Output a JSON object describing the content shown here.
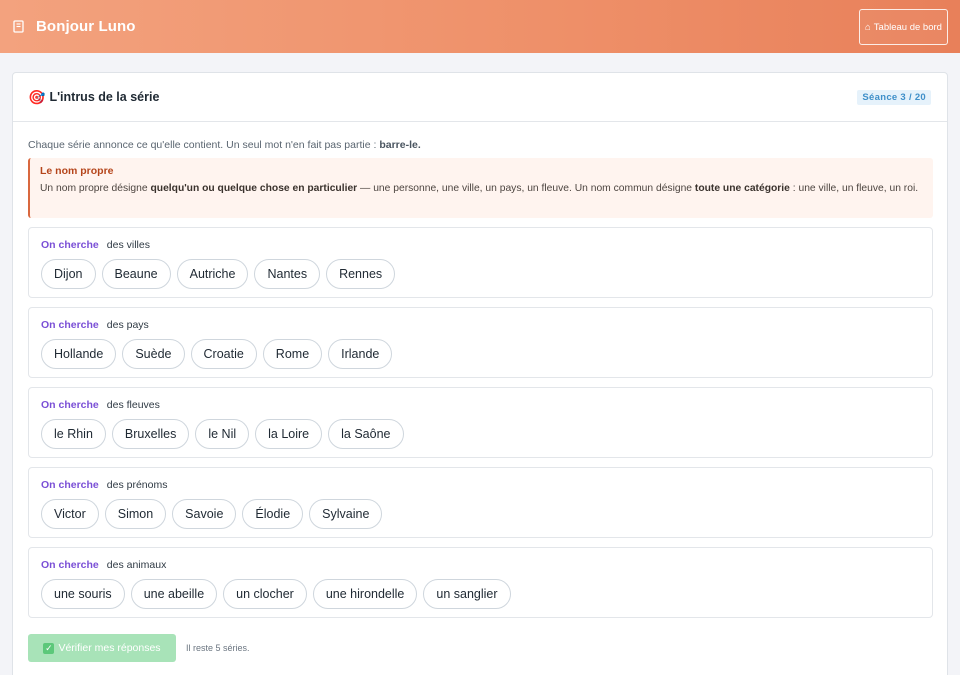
{
  "header": {
    "title": "Bonjour Luno",
    "dashboard_label": "Tableau de bord"
  },
  "card": {
    "title": "L'intrus de la série",
    "badge": "Séance 3 / 20",
    "intro_text": "Chaque série annonce ce qu'elle contient. Un seul mot n'en fait pas partie : ",
    "intro_strong": "barre-le."
  },
  "rule": {
    "title": "Le nom propre",
    "t1": "Un nom propre désigne ",
    "b1": "quelqu'un ou quelque chose en particulier",
    "t2": " — une personne, une ville, un pays, un fleuve. Un nom commun désigne ",
    "b2": "toute une catégorie",
    "t3": " : une ville, un fleuve, un roi."
  },
  "series": [
    {
      "key": "On cherche",
      "value": "des villes",
      "words": [
        "Dijon",
        "Beaune",
        "Autriche",
        "Nantes",
        "Rennes"
      ]
    },
    {
      "key": "On cherche",
      "value": "des pays",
      "words": [
        "Hollande",
        "Suède",
        "Croatie",
        "Rome",
        "Irlande"
      ]
    },
    {
      "key": "On cherche",
      "value": "des fleuves",
      "words": [
        "le Rhin",
        "Bruxelles",
        "le Nil",
        "la Loire",
        "la Saône"
      ]
    },
    {
      "key": "On cherche",
      "value": "des prénoms",
      "words": [
        "Victor",
        "Simon",
        "Savoie",
        "Élodie",
        "Sylvaine"
      ]
    },
    {
      "key": "On cherche",
      "value": "des animaux",
      "words": [
        "une souris",
        "une abeille",
        "un clocher",
        "une hirondelle",
        "un sanglier"
      ]
    }
  ],
  "footer": {
    "verify_label": "Vérifier mes réponses",
    "remaining": "Il reste 5 séries."
  },
  "colors": {
    "accent": "#ee8f68",
    "keyword": "#7a4fd6",
    "rule_border": "#d9683f",
    "verify": "#a8e3b8"
  }
}
